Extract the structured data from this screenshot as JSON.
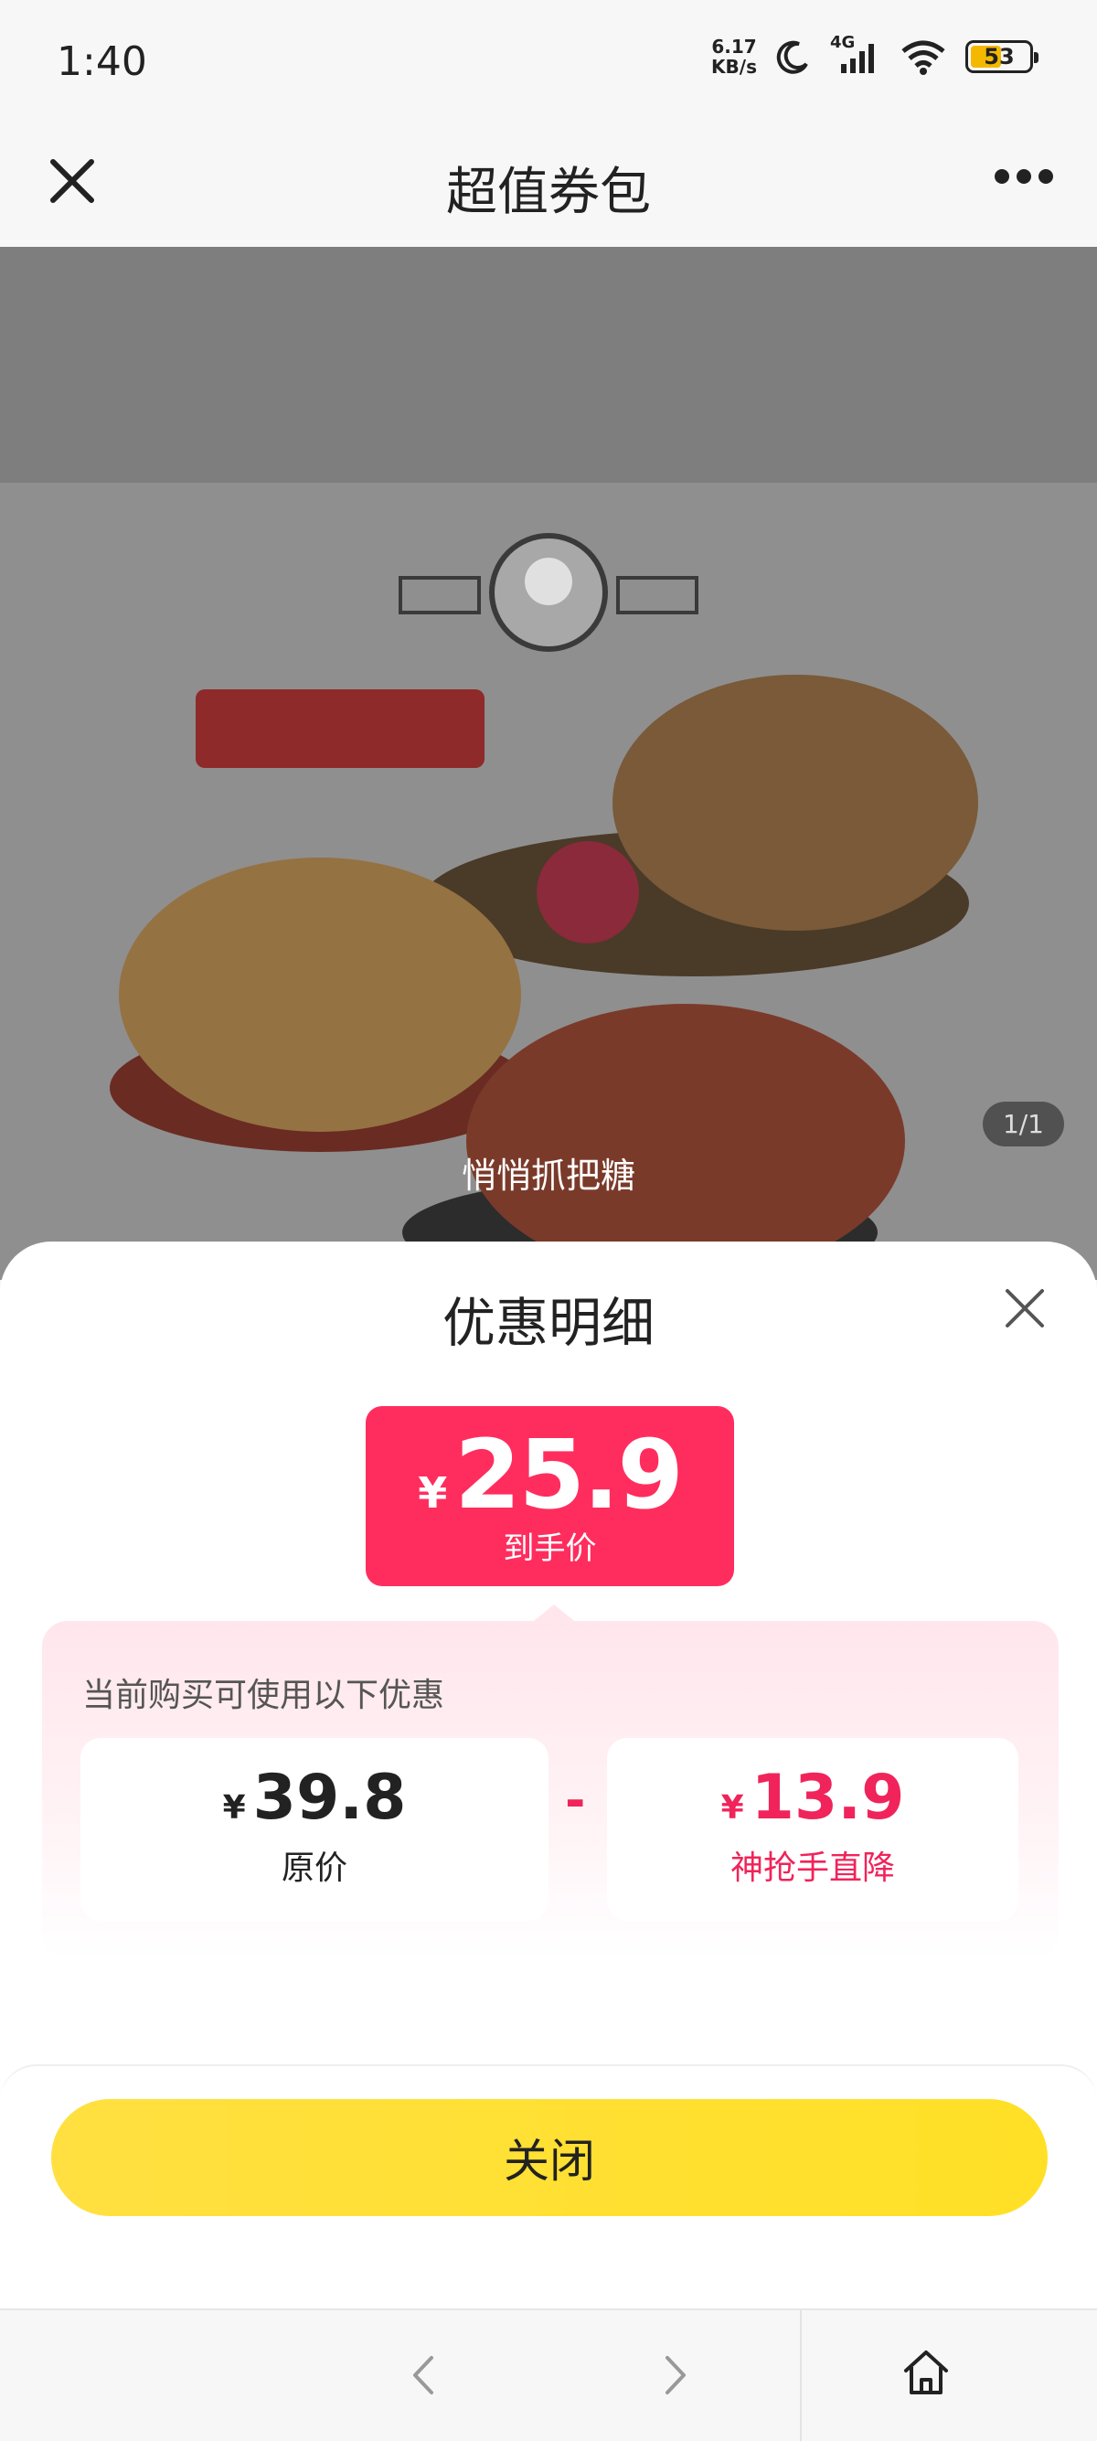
{
  "status_bar": {
    "time": "1:40",
    "net_speed_value": "6.17",
    "net_speed_unit": "KB/s",
    "network": "4G",
    "battery": "53",
    "battery_level": 0.53,
    "icons": [
      "moon-icon",
      "signal-icon",
      "wifi-icon",
      "battery-icon"
    ]
  },
  "nav": {
    "title": "超值券包",
    "close_icon": "close-icon",
    "more_icon": "more-icon"
  },
  "hero": {
    "caption": "悄悄抓把糖",
    "image_counter": "1/1"
  },
  "sheet": {
    "title": "优惠明细",
    "final_price": {
      "currency": "¥",
      "value": "25.9",
      "label": "到手价"
    },
    "discount_heading": "当前购买可使用以下优惠",
    "original": {
      "currency": "¥",
      "value": "39.8",
      "label": "原价"
    },
    "operator": "-",
    "discount": {
      "currency": "¥",
      "value": "13.9",
      "label": "神抢手直降"
    },
    "close_button": "关闭"
  },
  "colors": {
    "accent_red": "#ff2d5e",
    "discount_red": "#f0245a",
    "button_yellow": "#ffe033"
  }
}
